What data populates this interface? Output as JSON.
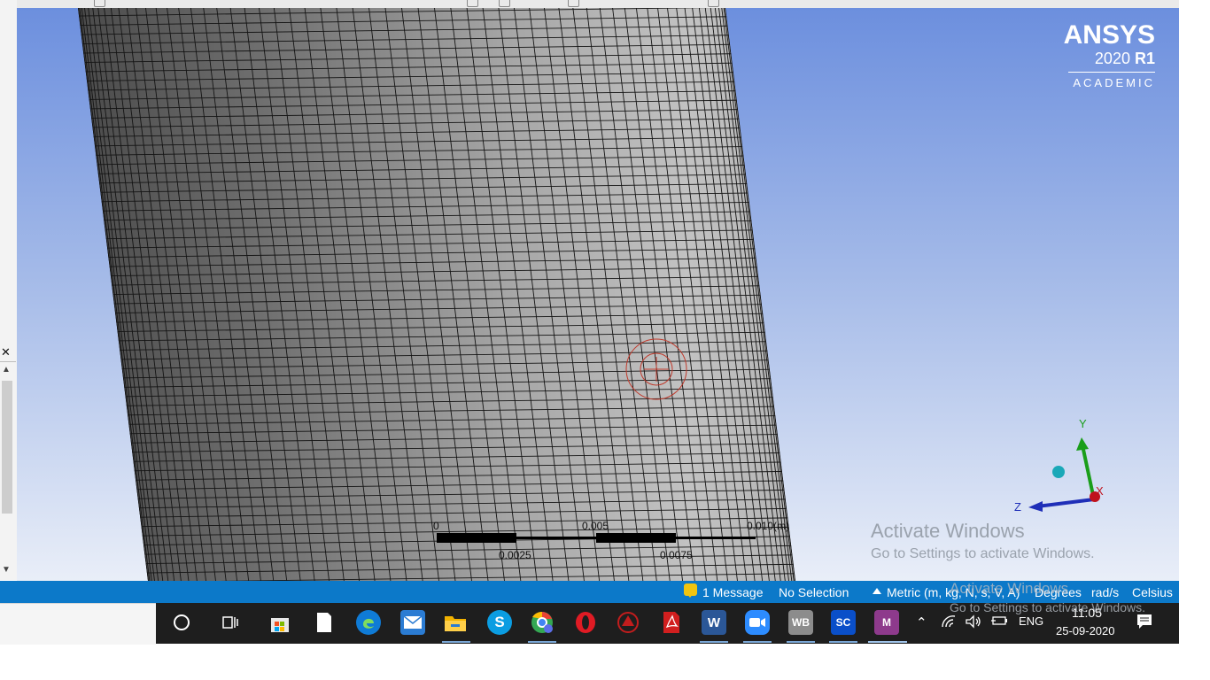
{
  "logo": {
    "brand": "ANSYS",
    "version": "2020",
    "release": "R1",
    "edition": "ACADEMIC"
  },
  "scale_bar": {
    "labels_top": [
      "0",
      "0.005",
      "0.010(m)"
    ],
    "labels_bottom": [
      "0.0025",
      "0.0075"
    ]
  },
  "triad": {
    "y": "Y",
    "x": "X",
    "z": "Z"
  },
  "activation": {
    "title": "Activate Windows",
    "subtitle": "Go to Settings to activate Windows."
  },
  "statusbar": {
    "messages": "1 Message",
    "selection": "No Selection",
    "units": "Metric (m, kg, N, s, V, A)",
    "angle": "Degrees",
    "angular_velocity": "rad/s",
    "temperature": "Celsius"
  },
  "taskbar": {
    "apps": [
      {
        "name": "search-cortana",
        "color": "#1e1e1e"
      },
      {
        "name": "task-view",
        "color": "#1e1e1e"
      },
      {
        "name": "microsoft-store",
        "color": "#1e1e1e"
      },
      {
        "name": "notepad",
        "color": "#1e1e1e"
      },
      {
        "name": "edge",
        "color": "#0f7bd6"
      },
      {
        "name": "mail",
        "color": "#2b7cd3"
      },
      {
        "name": "file-explorer",
        "color": "#f2b200"
      },
      {
        "name": "skype",
        "color": "#0b9de2"
      },
      {
        "name": "chrome",
        "color": "#34a853"
      },
      {
        "name": "opera",
        "color": "#e01b24"
      },
      {
        "name": "autodesk",
        "color": "#c21d1d"
      },
      {
        "name": "acrobat",
        "color": "#d11f1f"
      },
      {
        "name": "word",
        "color": "#2b5797"
      },
      {
        "name": "zoom",
        "color": "#2d8cff"
      },
      {
        "name": "workbench",
        "color": "#8c8c8c"
      },
      {
        "name": "spaceclaim",
        "color": "#0a4fc9"
      },
      {
        "name": "mechanical",
        "color": "#8e3a8c"
      }
    ],
    "wb_label": "WB",
    "sc_label": "SC",
    "m_label": "M",
    "language": "ENG",
    "time": "11:05",
    "date": "25-09-2020"
  }
}
